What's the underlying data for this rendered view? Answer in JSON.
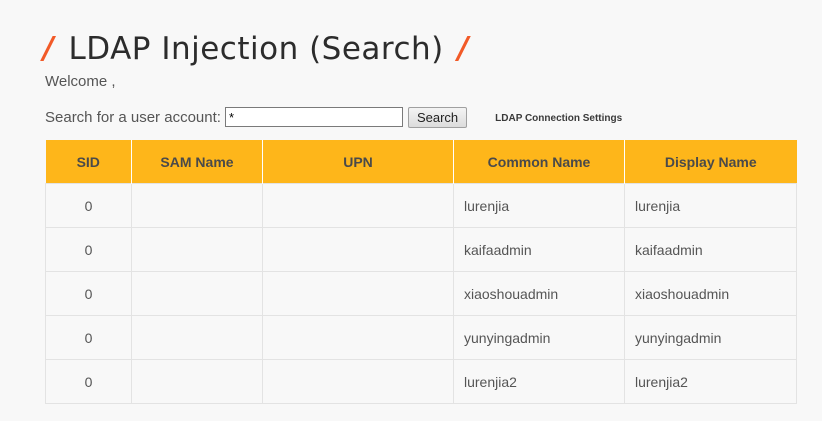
{
  "page": {
    "title": "LDAP Injection (Search)",
    "title_decor": "/"
  },
  "welcome": "Welcome ,",
  "search": {
    "label": "Search for a user account:",
    "value": "*",
    "button_label": "Search",
    "settings_link": "LDAP Connection Settings"
  },
  "table": {
    "columns": [
      "SID",
      "SAM Name",
      "UPN",
      "Common Name",
      "Display Name"
    ],
    "rows": [
      [
        "0",
        "",
        "",
        "lurenjia",
        "lurenjia"
      ],
      [
        "0",
        "",
        "",
        "kaifaadmin",
        "kaifaadmin"
      ],
      [
        "0",
        "",
        "",
        "xiaoshouadmin",
        "xiaoshouadmin"
      ],
      [
        "0",
        "",
        "",
        "yunyingadmin",
        "yunyingadmin"
      ],
      [
        "0",
        "",
        "",
        "lurenjia2",
        "lurenjia2"
      ]
    ]
  },
  "colors": {
    "accent": "#f25a28",
    "table_header": "#feb61a",
    "background": "#f8f8f8"
  }
}
